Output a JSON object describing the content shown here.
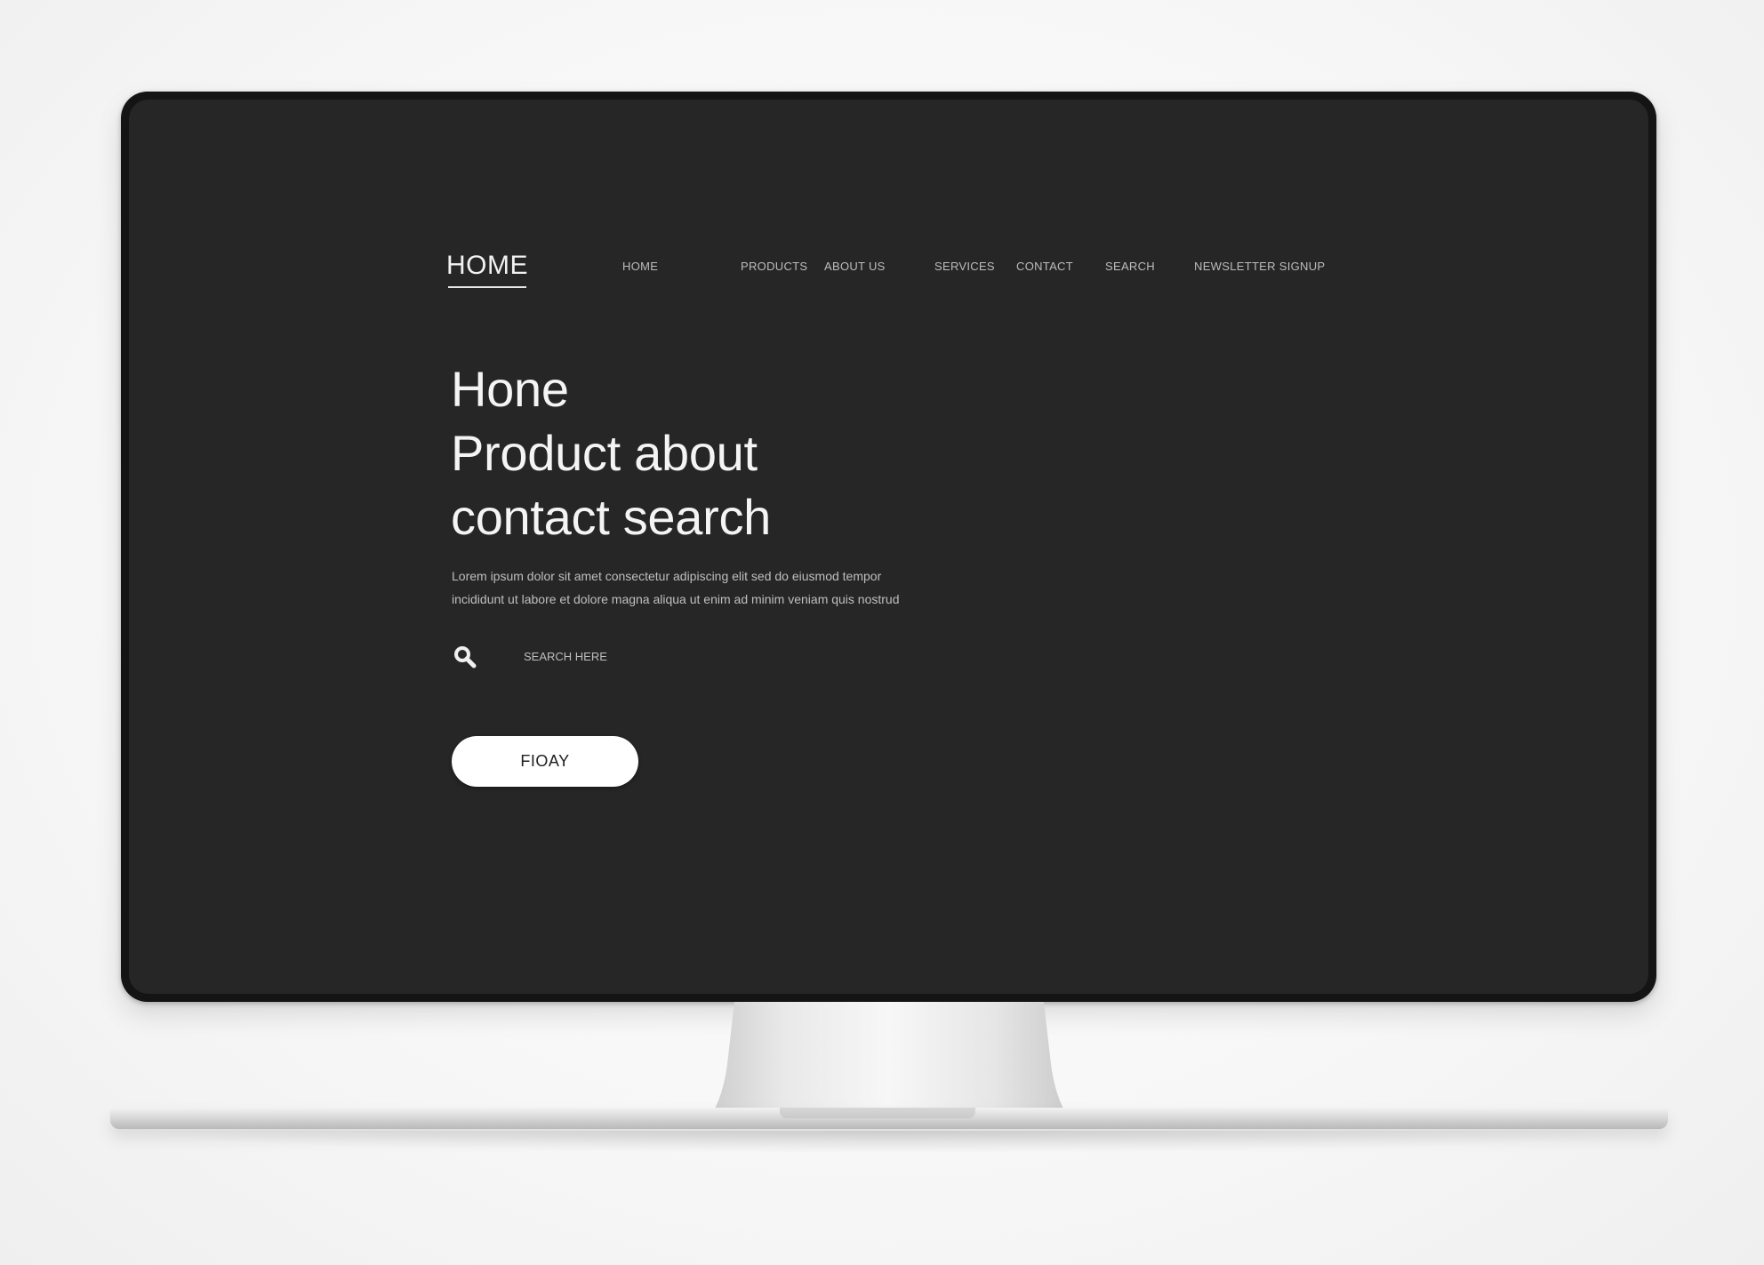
{
  "header": {
    "logo": "HOME",
    "nav": [
      {
        "label": "HOME"
      },
      {
        "label": "PRODUCTS"
      },
      {
        "label": "ABOUT US"
      },
      {
        "label": "SERVICES"
      },
      {
        "label": "CONTACT"
      },
      {
        "label": "SEARCH"
      },
      {
        "label": "NEWSLETTER SIGNUP"
      }
    ]
  },
  "hero": {
    "title_lines": [
      "Hone",
      "Product about",
      "contact search"
    ],
    "body_lines": [
      "Lorem ipsum dolor sit amet consectetur adipiscing elit sed do eiusmod tempor",
      "incididunt ut labore et dolore magna aliqua ut enim ad minim veniam quis nostrud"
    ],
    "search_label": "SEARCH HERE",
    "cta_label": "FIOAY"
  },
  "icons": {
    "search": "magnifier-icon"
  },
  "colors": {
    "screen": "#262626",
    "bezel": "#141414",
    "text": "#f4f4f4",
    "muted": "#bdbdbd",
    "button_bg": "#ffffff",
    "button_text": "#202020"
  }
}
